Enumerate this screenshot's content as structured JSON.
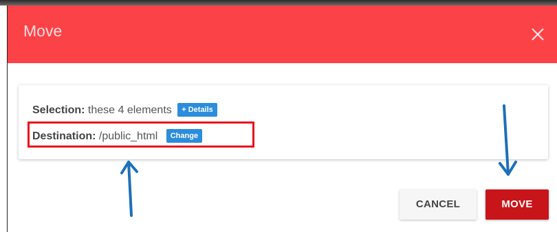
{
  "dialog": {
    "title": "Move",
    "close_icon": "close-icon"
  },
  "selection": {
    "label": "Selection:",
    "value": "these 4 elements",
    "details_button": "+ Details"
  },
  "destination": {
    "label": "Destination:",
    "value": "/public_html",
    "change_button": "Change"
  },
  "actions": {
    "cancel_label": "CANCEL",
    "move_label": "MOVE"
  },
  "annotations": {
    "highlight_color": "#e8101a",
    "arrow_color": "#1e6fb8"
  },
  "colors": {
    "header": "#fb4247",
    "accent_blue": "#2b8ddb",
    "primary_button": "#c8151a"
  }
}
